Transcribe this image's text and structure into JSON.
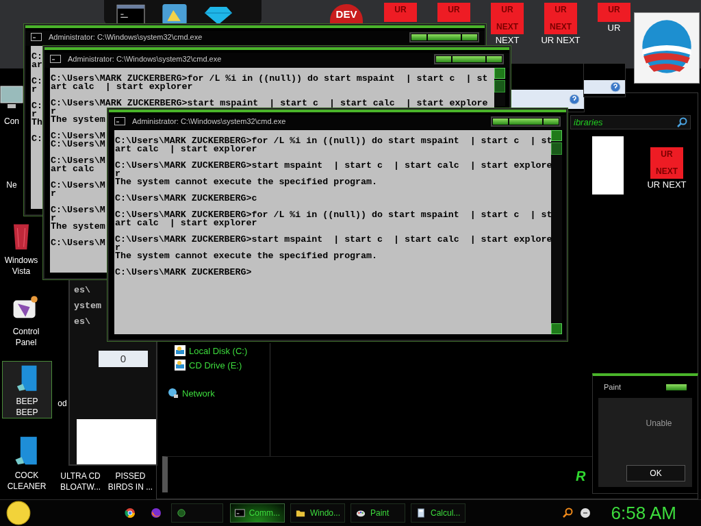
{
  "top_strip": {
    "logo_text": "DEV"
  },
  "ur_tiles": [
    {
      "top": "UR"
    },
    {
      "top": "UR"
    },
    {
      "top": "UR",
      "bottom": "NEXT",
      "caption": "NEXT"
    },
    {
      "top": "UR",
      "bottom": "NEXT",
      "caption": "UR NEXT"
    },
    {
      "top": "UR",
      "caption": "UR"
    },
    {
      "top": "UR",
      "bottom": "NEXT",
      "caption": "UR NEXT"
    }
  ],
  "desktop_icons": [
    {
      "label_lines": [
        "Con"
      ],
      "kind": "monitor",
      "selected": false
    },
    {
      "label_lines": [
        "Ne"
      ],
      "kind": "hidden",
      "selected": false
    },
    {
      "label_lines": [
        "Windows",
        "Vista"
      ],
      "kind": "bin",
      "selected": false
    },
    {
      "label_lines": [
        "Control",
        "Panel"
      ],
      "kind": "control",
      "selected": false
    },
    {
      "label_lines": [
        "BEEP",
        "BEEP"
      ],
      "kind": "doc",
      "selected": true
    },
    {
      "label_lines": [
        "od"
      ],
      "kind": "hidden",
      "selected": false
    },
    {
      "label_lines": [
        "COCK",
        "CLEANER"
      ],
      "kind": "doc",
      "selected": false
    },
    {
      "label_lines": [
        "ULTRA CD",
        "BLOATW..."
      ],
      "kind": "hidden",
      "selected": false
    },
    {
      "label_lines": [
        "PISSED",
        "BIRDS IN ..."
      ],
      "kind": "hidden",
      "selected": false
    }
  ],
  "explorer": {
    "search_text": "ibraries",
    "nav_items": [
      {
        "label": "Local Disk (C:)",
        "kind": "disk"
      },
      {
        "label": "CD Drive (E:)",
        "kind": "disk"
      },
      {
        "label": "Network",
        "kind": "network"
      }
    ],
    "corner_text": "R"
  },
  "calculator": {
    "fragments": [
      "es\\",
      "ystem",
      "es\\"
    ],
    "display": "0"
  },
  "consoles": [
    {
      "title": "Administrator: C:\\Windows\\system32\\cmd.exe",
      "scrollbar": false,
      "blocks": [
        [
          "C:",
          "ar"
        ],
        [
          "C:",
          "r"
        ],
        [
          "C:",
          "r",
          "Th"
        ],
        [
          "C:"
        ]
      ]
    },
    {
      "title": "Administrator: C:\\Windows\\system32\\cmd.exe",
      "scrollbar": true,
      "blocks": [
        [
          "C:\\Users\\MARK ZUCKERBERG>for /L %i in ((null)) do start mspaint  | start c  | st",
          "art calc  | start explorer"
        ],
        [
          "C:\\Users\\MARK ZUCKERBERG>start mspaint  | start c  | start calc  | start explore",
          "r",
          "The system"
        ],
        [
          "C:\\Users\\M",
          "C:\\Users\\M"
        ],
        [
          "C:\\Users\\M",
          "art calc"
        ],
        [
          "C:\\Users\\M",
          "r"
        ],
        [
          "C:\\Users\\M",
          "r",
          "The system"
        ],
        [
          "C:\\Users\\M"
        ]
      ]
    },
    {
      "title": "Administrator: C:\\Windows\\system32\\cmd.exe",
      "scrollbar": true,
      "blocks": [
        [
          "C:\\Users\\MARK ZUCKERBERG>for /L %i in ((null)) do start mspaint  | start c  | st",
          "art calc  | start explorer"
        ],
        [
          "C:\\Users\\MARK ZUCKERBERG>start mspaint  | start c  | start calc  | start explore",
          "r",
          "The system cannot execute the specified program."
        ],
        [
          "C:\\Users\\MARK ZUCKERBERG>c"
        ],
        [
          "C:\\Users\\MARK ZUCKERBERG>for /L %i in ((null)) do start mspaint  | start c  | st",
          "art calc  | start explorer"
        ],
        [
          "C:\\Users\\MARK ZUCKERBERG>start mspaint  | start c  | start calc  | start explore",
          "r",
          "The system cannot execute the specified program."
        ],
        [
          "C:\\Users\\MARK ZUCKERBERG>"
        ]
      ]
    }
  ],
  "paint_dialog": {
    "title": "Paint",
    "message": "Unable",
    "button": "OK"
  },
  "taskbar": {
    "tasks": [
      {
        "kind": "blank",
        "selected": false
      },
      {
        "label": "Comm...",
        "kind": "cmd",
        "selected": true
      },
      {
        "label": "Windo...",
        "kind": "folder",
        "selected": false
      },
      {
        "label": "Paint",
        "kind": "paint",
        "selected": false
      },
      {
        "label": "Calcul...",
        "kind": "calc",
        "selected": false
      }
    ],
    "clock": "6:58 AM"
  }
}
